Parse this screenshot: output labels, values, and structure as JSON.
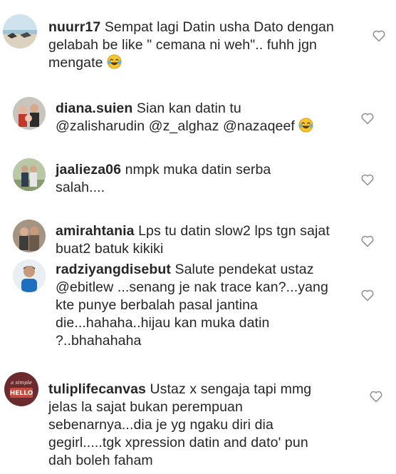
{
  "comments": [
    {
      "username": "nuurr17",
      "text": " Sempat lagi Datin usha Dato dengan gelabah be like \" cemana ni weh\".. fuhh jgn mengate",
      "emoji": "laughing-tears-emoji",
      "avatar": "beach-avatar"
    },
    {
      "username": "diana.suien",
      "text": " Sian kan datin tu",
      "mentions": [
        "@zalisharudin",
        "@z_alghaz",
        "@nazaqeef"
      ],
      "emoji": "laughing-tears-emoji",
      "avatar": "group-photo-avatar"
    },
    {
      "username": "jaalieza06",
      "text": " nmpk muka datin serba salah....",
      "avatar": "outdoor-couple-avatar"
    },
    {
      "username": "amirahtania",
      "text": " Lps tu datin slow2 lps tgn sajat buat2 batuk kikiki",
      "avatar": "indoor-couple-avatar"
    },
    {
      "username": "radziyangdisebut",
      "text": " Salute pendekat ustaz ",
      "mention": "@ebitlew",
      "text_after": " ...senang je nak trace kan?...yang kte punye berbalah pasal jantina die...hahaha..hijau kan muka datin ?..bhahahaha",
      "avatar": "portrait-avatar"
    },
    {
      "username": "tuliplifecanvas",
      "text": " Ustaz x sengaja tapi mmg jelas la sajat bukan perempuan sebenarnya...dia je yg ngaku diri dia gegirl.....tgk xpression datin and dato' pun dah boleh faham",
      "avatar": "hello-sign-avatar",
      "avatar_text_top": "a simple",
      "avatar_text_main": "HELLO"
    }
  ],
  "colors": {
    "text": "#262626",
    "heart_stroke": "#8e8e8e",
    "background": "#ffffff"
  },
  "icons": {
    "like": "heart-outline-icon"
  }
}
